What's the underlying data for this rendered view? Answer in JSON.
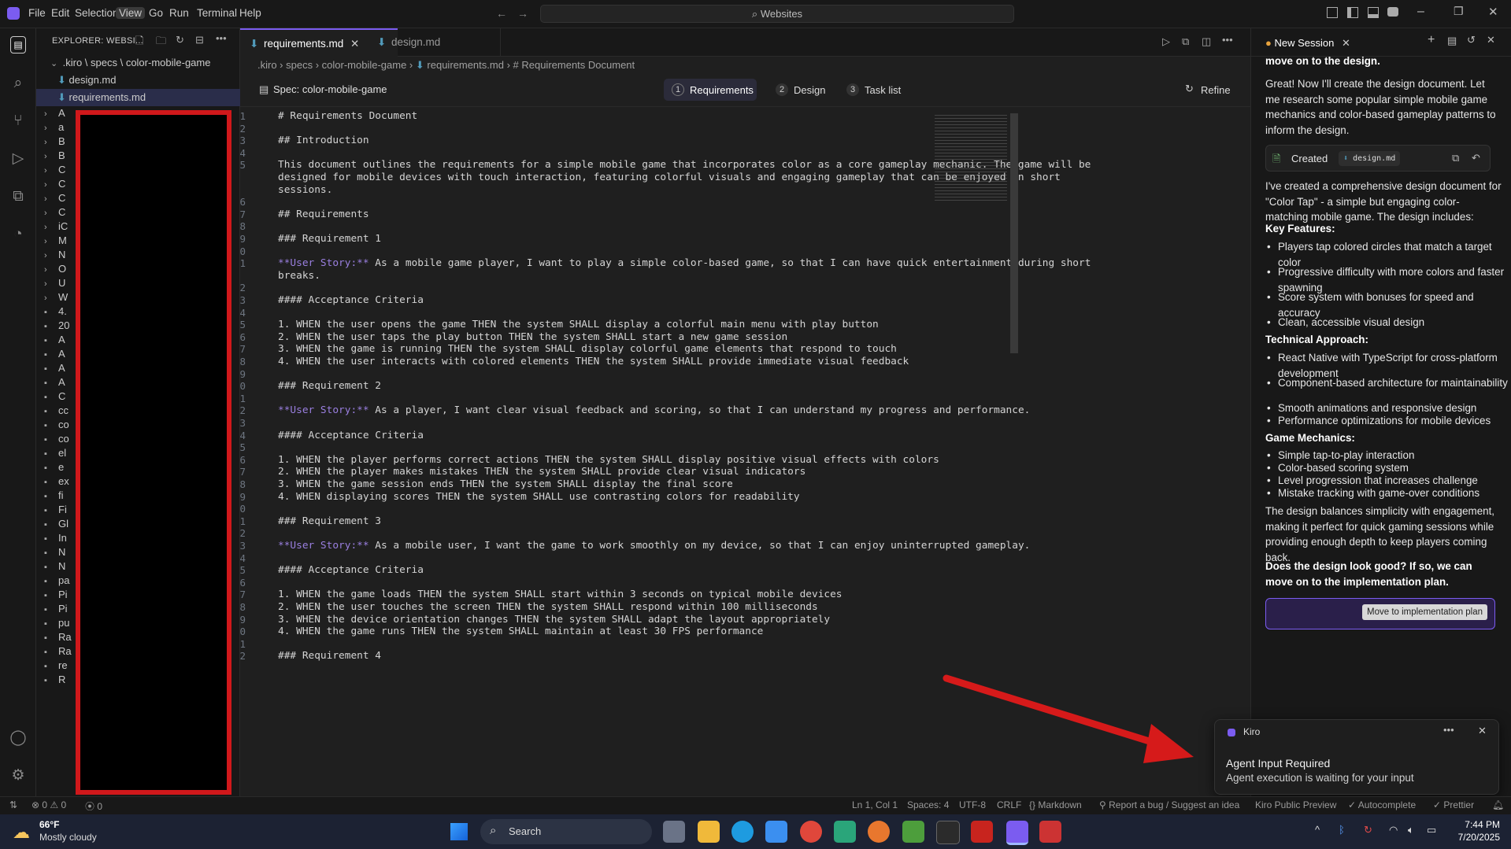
{
  "titlebar": {
    "menus": [
      "File",
      "Edit",
      "Selection",
      "View",
      "Go",
      "Run",
      "Terminal",
      "Help"
    ],
    "search_text": "Websites"
  },
  "explorer": {
    "title": "EXPLORER: WEBSI...",
    "root_path": ".kiro \\ specs \\ color-mobile-game",
    "files": [
      "design.md",
      "requirements.md"
    ],
    "collapsed_prefixes": [
      "A",
      "a",
      "B",
      "B",
      "C",
      "C",
      "C",
      "C",
      "iC",
      "M",
      "N",
      "O",
      "U",
      "W",
      "4.",
      "20",
      "A",
      "A",
      "A",
      "A",
      "C",
      "cc",
      "co",
      "co",
      "el",
      "e",
      "ex",
      "fi",
      "Fi",
      "Gl",
      "In",
      "N",
      "N",
      "pa",
      "Pi",
      "Pi",
      "pu",
      "Ra",
      "Ra",
      "re",
      "R"
    ]
  },
  "editor": {
    "tabs": [
      {
        "label": "requirements.md",
        "active": true
      },
      {
        "label": "design.md",
        "active": false
      }
    ],
    "breadcrumb": [
      ".kiro",
      "specs",
      "color-mobile-game",
      "requirements.md",
      "# Requirements Document"
    ],
    "spec_label": "Spec: color-mobile-game",
    "steps": [
      {
        "num": "1",
        "label": "Requirements",
        "active": true
      },
      {
        "num": "2",
        "label": "Design",
        "active": false
      },
      {
        "num": "3",
        "label": "Task list",
        "active": false
      }
    ],
    "refine_label": "Refine",
    "lines": [
      {
        "n": "1",
        "t": "# Requirements Document",
        "k": "h"
      },
      {
        "n": "2",
        "t": "",
        "k": ""
      },
      {
        "n": "3",
        "t": "## Introduction",
        "k": "h"
      },
      {
        "n": "4",
        "t": "",
        "k": ""
      },
      {
        "n": "5",
        "t": "This document outlines the requirements for a simple mobile game that incorporates color as a core gameplay mechanic. The game will be",
        "k": ""
      },
      {
        "n": "",
        "t": "designed for mobile devices with touch interaction, featuring colorful visuals and engaging gameplay that can be enjoyed in short",
        "k": ""
      },
      {
        "n": "",
        "t": "sessions.",
        "k": ""
      },
      {
        "n": "6",
        "t": "",
        "k": ""
      },
      {
        "n": "7",
        "t": "## Requirements",
        "k": "h"
      },
      {
        "n": "8",
        "t": "",
        "k": ""
      },
      {
        "n": "9",
        "t": "### Requirement 1",
        "k": "h"
      },
      {
        "n": "10",
        "t": "",
        "k": ""
      },
      {
        "n": "11",
        "t": "As a mobile game player, I want to play a simple color-based game, so that I can have quick entertainment during short",
        "k": "us"
      },
      {
        "n": "",
        "t": "breaks.",
        "k": ""
      },
      {
        "n": "12",
        "t": "",
        "k": ""
      },
      {
        "n": "13",
        "t": "#### Acceptance Criteria",
        "k": "h"
      },
      {
        "n": "14",
        "t": "",
        "k": ""
      },
      {
        "n": "15",
        "t": "1. WHEN the user opens the game THEN the system SHALL display a colorful main menu with play button",
        "k": ""
      },
      {
        "n": "16",
        "t": "2. WHEN the user taps the play button THEN the system SHALL start a new game session",
        "k": ""
      },
      {
        "n": "17",
        "t": "3. WHEN the game is running THEN the system SHALL display colorful game elements that respond to touch",
        "k": ""
      },
      {
        "n": "18",
        "t": "4. WHEN the user interacts with colored elements THEN the system SHALL provide immediate visual feedback",
        "k": ""
      },
      {
        "n": "19",
        "t": "",
        "k": ""
      },
      {
        "n": "20",
        "t": "### Requirement 2",
        "k": "h"
      },
      {
        "n": "21",
        "t": "",
        "k": ""
      },
      {
        "n": "22",
        "t": "As a player, I want clear visual feedback and scoring, so that I can understand my progress and performance.",
        "k": "us"
      },
      {
        "n": "23",
        "t": "",
        "k": ""
      },
      {
        "n": "24",
        "t": "#### Acceptance Criteria",
        "k": "h"
      },
      {
        "n": "25",
        "t": "",
        "k": ""
      },
      {
        "n": "26",
        "t": "1. WHEN the player performs correct actions THEN the system SHALL display positive visual effects with colors",
        "k": ""
      },
      {
        "n": "27",
        "t": "2. WHEN the player makes mistakes THEN the system SHALL provide clear visual indicators",
        "k": ""
      },
      {
        "n": "28",
        "t": "3. WHEN the game session ends THEN the system SHALL display the final score",
        "k": ""
      },
      {
        "n": "29",
        "t": "4. WHEN displaying scores THEN the system SHALL use contrasting colors for readability",
        "k": ""
      },
      {
        "n": "30",
        "t": "",
        "k": ""
      },
      {
        "n": "31",
        "t": "### Requirement 3",
        "k": "h"
      },
      {
        "n": "32",
        "t": "",
        "k": ""
      },
      {
        "n": "33",
        "t": "As a mobile user, I want the game to work smoothly on my device, so that I can enjoy uninterrupted gameplay.",
        "k": "us"
      },
      {
        "n": "34",
        "t": "",
        "k": ""
      },
      {
        "n": "35",
        "t": "#### Acceptance Criteria",
        "k": "h"
      },
      {
        "n": "36",
        "t": "",
        "k": ""
      },
      {
        "n": "37",
        "t": "1. WHEN the game loads THEN the system SHALL start within 3 seconds on typical mobile devices",
        "k": ""
      },
      {
        "n": "38",
        "t": "2. WHEN the user touches the screen THEN the system SHALL respond within 100 milliseconds",
        "k": ""
      },
      {
        "n": "39",
        "t": "3. WHEN the device orientation changes THEN the system SHALL adapt the layout appropriately",
        "k": ""
      },
      {
        "n": "40",
        "t": "4. WHEN the game runs THEN the system SHALL maintain at least 30 FPS performance",
        "k": ""
      },
      {
        "n": "41",
        "t": "",
        "k": ""
      },
      {
        "n": "42",
        "t": "### Requirement 4",
        "k": "h"
      }
    ],
    "user_story_prefix": "**User Story:**"
  },
  "chat": {
    "tab_label": "New Session",
    "intro_bold": "move on to the design.",
    "p1": "Great! Now I'll create the design document. Let me research some popular simple mobile game mechanics and color-based gameplay patterns to inform the design.",
    "created_label": "Created",
    "created_file": "design.md",
    "p2": "I've created a comprehensive design document for \"Color Tap\" - a simple but engaging color-matching mobile game. The design includes:",
    "h_features": "Key Features:",
    "features": [
      "Players tap colored circles that match a target color",
      "Progressive difficulty with more colors and faster spawning",
      "Score system with bonuses for speed and accuracy",
      "Clean, accessible visual design"
    ],
    "h_tech": "Technical Approach:",
    "tech": [
      "React Native with TypeScript for cross-platform development",
      "Component-based architecture for maintainability",
      "Smooth animations and responsive design",
      "Performance optimizations for mobile devices"
    ],
    "h_mech": "Game Mechanics:",
    "mech": [
      "Simple tap-to-play interaction",
      "Color-based scoring system",
      "Level progression that increases challenge",
      "Mistake tracking with game-over conditions"
    ],
    "p3": "The design balances simplicity with engagement, making it perfect for quick gaming sessions while providing enough depth to keep players coming back.",
    "question": "Does the design look good? If so, we can move on to the implementation plan.",
    "action_button": "Move to implementation plan"
  },
  "notification": {
    "app": "Kiro",
    "title": "Agent Input Required",
    "body": "Agent execution is waiting for your input"
  },
  "statusbar": {
    "errors": "0",
    "warnings": "0",
    "ports": "0",
    "position": "Ln 1, Col 1",
    "spaces": "Spaces: 4",
    "encoding": "UTF-8",
    "eol": "CRLF",
    "language": "Markdown",
    "report": "Report a bug / Suggest an idea",
    "preview": "Kiro Public Preview",
    "autocomplete": "Autocomplete",
    "prettier": "Prettier"
  },
  "taskbar": {
    "temp": "66°F",
    "weather": "Mostly cloudy",
    "search": "Search",
    "time": "7:44 PM",
    "date": "7/20/2025"
  },
  "colors": {
    "accent": "#7b5cf0",
    "redact_border": "#d0181b",
    "arrow": "#d61a1a"
  }
}
